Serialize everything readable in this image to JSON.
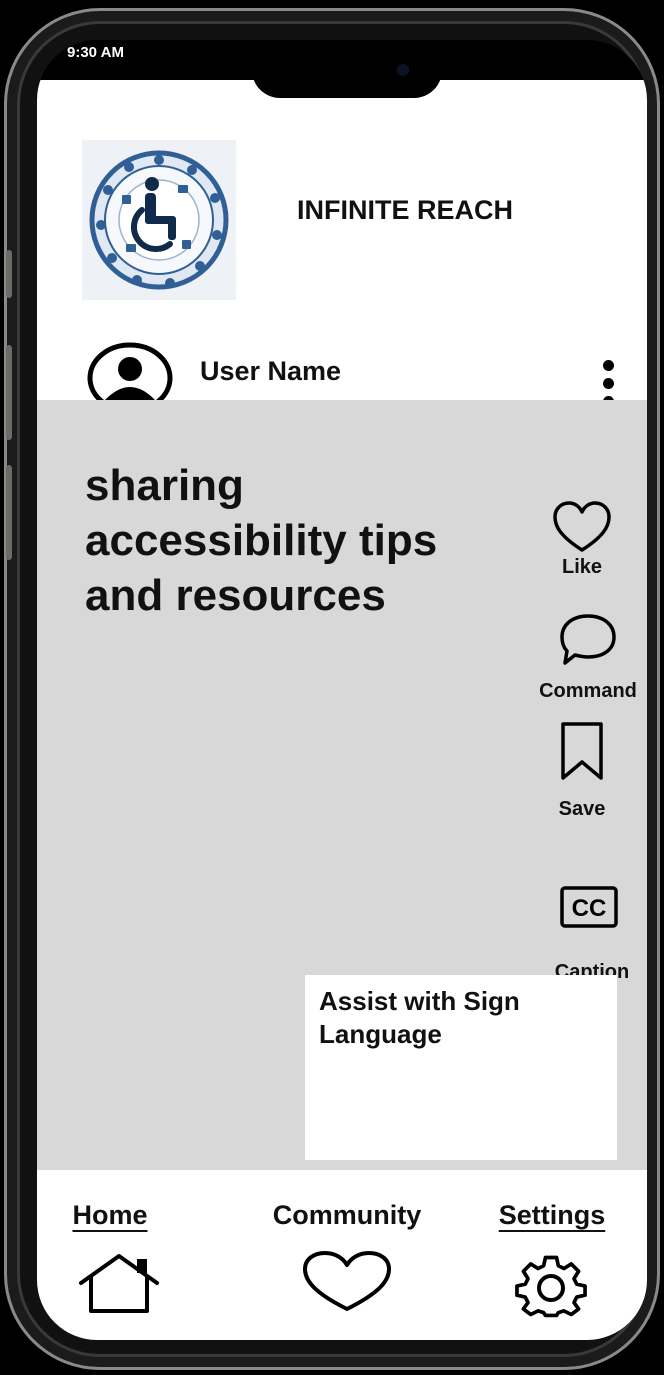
{
  "status_bar": {
    "time": "9:30 AM"
  },
  "header": {
    "app_title": "INFINITE REACH",
    "logo_icon": "wheelchair-accessibility-logo"
  },
  "profile": {
    "user_name": "User Name",
    "avatar_icon": "user-avatar-icon",
    "menu_icon": "more-vertical-icon"
  },
  "post": {
    "text": "sharing accessibility tips and resources",
    "actions": [
      {
        "label": "Like",
        "icon": "heart-icon"
      },
      {
        "label": "Command",
        "icon": "comment-icon"
      },
      {
        "label": "Save",
        "icon": "bookmark-icon"
      },
      {
        "label": "Caption",
        "icon": "closed-caption-icon",
        "icon_text": "CC"
      }
    ],
    "sign_language_box": "Assist with Sign Language"
  },
  "bottom_nav": {
    "items": [
      {
        "label": "Home",
        "icon": "home-icon",
        "underlined": true
      },
      {
        "label": "Community",
        "icon": "heart-icon",
        "underlined": false
      },
      {
        "label": "Settings",
        "icon": "gear-icon",
        "underlined": true
      }
    ]
  },
  "colors": {
    "post_background": "#d8d8d8",
    "surface": "#ffffff",
    "frame": "#000000",
    "logo_blue": "#2f5f94"
  }
}
